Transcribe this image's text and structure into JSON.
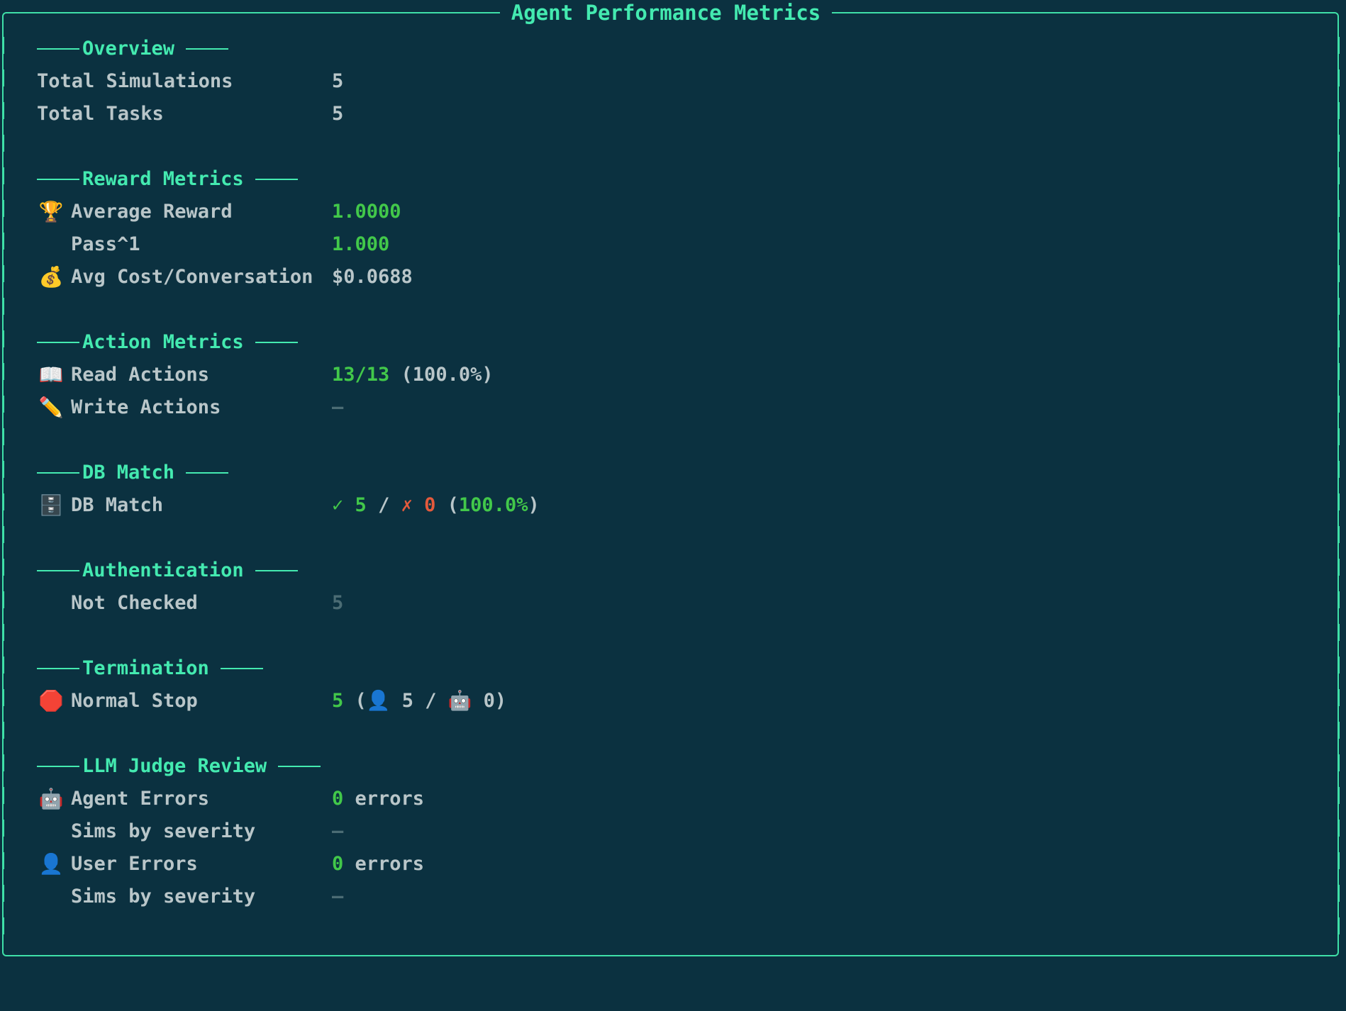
{
  "title": "Agent Performance Metrics",
  "colors": {
    "background": "#0b3140",
    "accent": "#44eab0",
    "text": "#b9c6c9",
    "good": "#42c84a",
    "bad": "#e45a3c",
    "muted": "#4b6c74"
  },
  "overview": {
    "heading": "Overview",
    "total_simulations_label": "Total Simulations",
    "total_simulations_value": "5",
    "total_tasks_label": "Total Tasks",
    "total_tasks_value": "5"
  },
  "reward": {
    "heading": "Reward Metrics",
    "avg_reward_icon": "trophy-icon",
    "avg_reward_label": "Average Reward",
    "avg_reward_value": "1.0000",
    "pass_label": "Pass^1",
    "pass_value": "1.000",
    "cost_icon": "money-bag-icon",
    "cost_label": "Avg Cost/Conversation",
    "cost_value": "$0.0688"
  },
  "action": {
    "heading": "Action Metrics",
    "read_icon": "open-book-icon",
    "read_label": "Read Actions",
    "read_value": "13/13",
    "read_pct": "(100.0%)",
    "write_icon": "pencil-icon",
    "write_label": "Write Actions",
    "write_value": "–"
  },
  "db": {
    "heading": "DB Match",
    "icon": "file-cabinet-icon",
    "label": "DB Match",
    "check": "✓",
    "pass": "5",
    "slash": "/",
    "cross": "✗",
    "fail": "0",
    "paren_open": "(",
    "pct": "100.0%",
    "paren_close": ")"
  },
  "auth": {
    "heading": "Authentication",
    "not_checked_label": "Not Checked",
    "not_checked_value": "5"
  },
  "termination": {
    "heading": "Termination",
    "icon": "stop-sign-icon",
    "label": "Normal Stop",
    "total": "5",
    "paren_open": "(",
    "user_icon": "user-silhouette-icon",
    "user_count": "5",
    "slash": "/",
    "robot_icon": "robot-icon",
    "agent_count": "0",
    "paren_close": ")"
  },
  "llm_judge": {
    "heading": "LLM Judge Review",
    "agent_icon": "robot-icon",
    "agent_errors_label": "Agent Errors",
    "agent_errors_count": "0",
    "agent_errors_unit": "errors",
    "agent_severity_label": "Sims by severity",
    "agent_severity_value": "–",
    "user_icon": "user-silhouette-icon",
    "user_errors_label": "User Errors",
    "user_errors_count": "0",
    "user_errors_unit": "errors",
    "user_severity_label": "Sims by severity",
    "user_severity_value": "–"
  }
}
